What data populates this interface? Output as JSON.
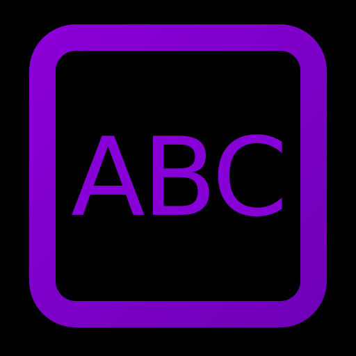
{
  "icon": {
    "name": "abc-text-icon",
    "text": "ABC",
    "colors": {
      "background": "#000000",
      "frame_gradient_start": "#8a00d8",
      "frame_gradient_end": "#7000b8",
      "text": "#8800d8"
    }
  }
}
